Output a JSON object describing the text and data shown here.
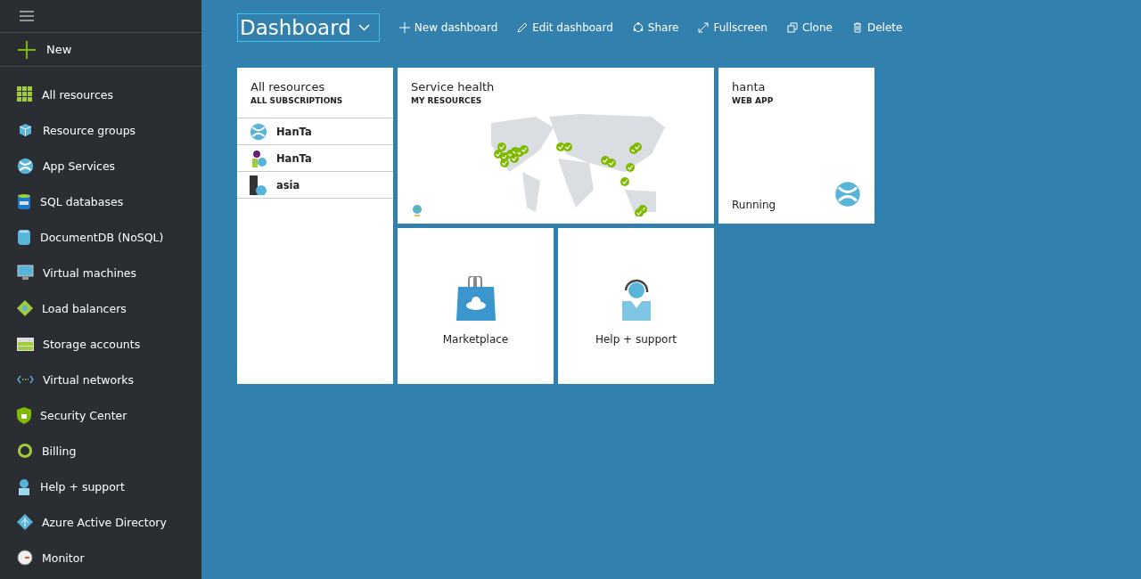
{
  "sidebar": {
    "new_label": "New",
    "items": [
      {
        "kind": "grid",
        "label": "All resources"
      },
      {
        "kind": "cube",
        "label": "Resource groups"
      },
      {
        "kind": "globe",
        "label": "App Services"
      },
      {
        "kind": "sql",
        "label": "SQL databases"
      },
      {
        "kind": "docdb",
        "label": "DocumentDB (NoSQL)"
      },
      {
        "kind": "vm",
        "label": "Virtual machines"
      },
      {
        "kind": "lb",
        "label": "Load balancers"
      },
      {
        "kind": "storage",
        "label": "Storage accounts"
      },
      {
        "kind": "vnet",
        "label": "Virtual networks"
      },
      {
        "kind": "shield",
        "label": "Security Center"
      },
      {
        "kind": "billing",
        "label": "Billing"
      },
      {
        "kind": "help",
        "label": "Help + support"
      },
      {
        "kind": "aad",
        "label": "Azure Active Directory"
      },
      {
        "kind": "monitor",
        "label": "Monitor"
      }
    ]
  },
  "header": {
    "title": "Dashboard",
    "actions": [
      {
        "kind": "plus",
        "label": "New dashboard"
      },
      {
        "kind": "pencil",
        "label": "Edit dashboard"
      },
      {
        "kind": "share",
        "label": "Share"
      },
      {
        "kind": "expand",
        "label": "Fullscreen"
      },
      {
        "kind": "clone",
        "label": "Clone"
      },
      {
        "kind": "trash",
        "label": "Delete"
      }
    ]
  },
  "tiles": [
    {
      "kind": "resources",
      "title": "All resources",
      "subtitle": "ALL SUBSCRIPTIONS",
      "rows": [
        {
          "kind": "globe",
          "name": "HanTa"
        },
        {
          "kind": "insight",
          "name": "HanTa"
        },
        {
          "kind": "server",
          "name": "asia"
        }
      ]
    },
    {
      "kind": "health",
      "title": "Service health",
      "subtitle": "MY RESOURCES"
    },
    {
      "kind": "webapp",
      "title": "hanta",
      "subtitle": "WEB APP",
      "status": "Running"
    },
    {
      "kind": "marketplace",
      "label": "Marketplace"
    },
    {
      "kind": "support",
      "label": "Help + support"
    }
  ]
}
